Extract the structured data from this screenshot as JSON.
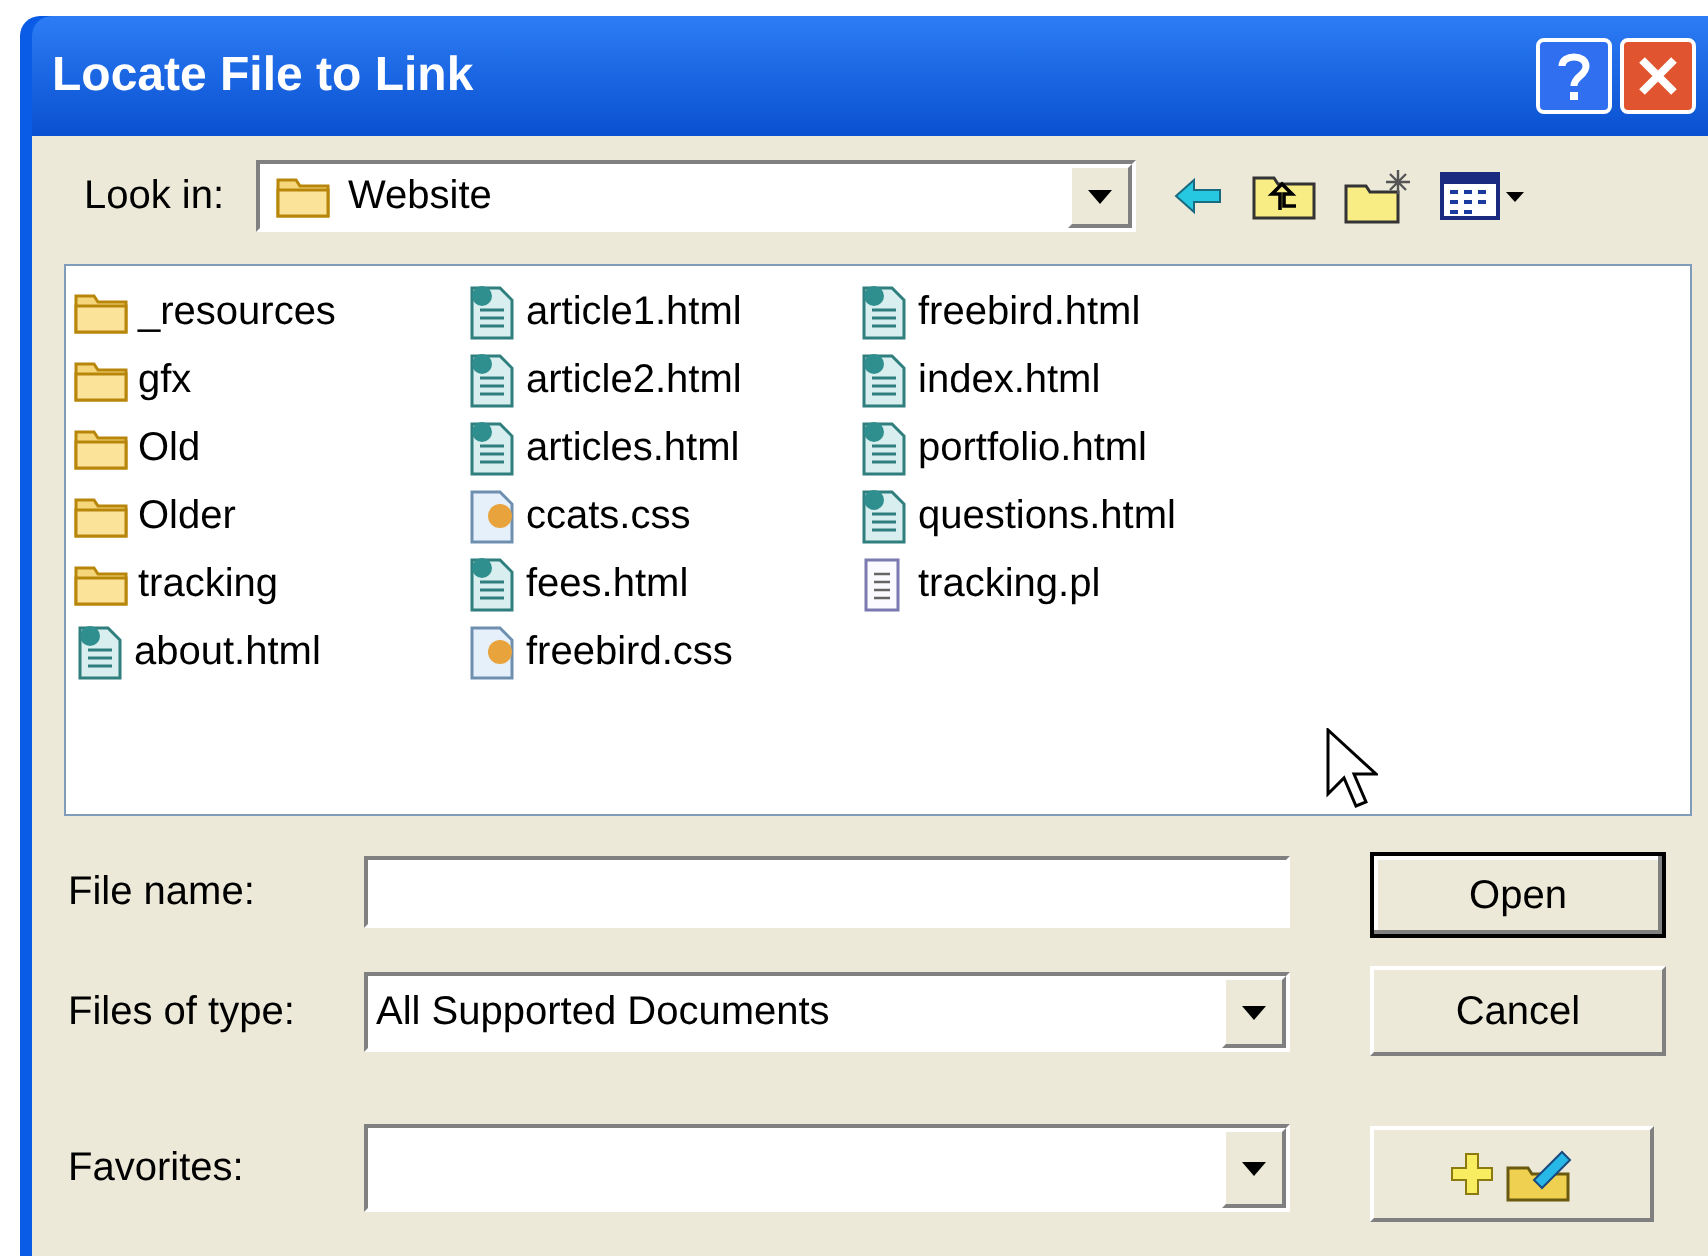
{
  "window": {
    "title": "Locate File to Link"
  },
  "look_in": {
    "label": "Look in:",
    "value": "Website"
  },
  "files": [
    [
      {
        "name": "_resources",
        "kind": "folder"
      },
      {
        "name": "gfx",
        "kind": "folder"
      },
      {
        "name": "Old",
        "kind": "folder"
      },
      {
        "name": "Older",
        "kind": "folder"
      },
      {
        "name": "tracking",
        "kind": "folder"
      },
      {
        "name": "about.html",
        "kind": "html"
      }
    ],
    [
      {
        "name": "article1.html",
        "kind": "html"
      },
      {
        "name": "article2.html",
        "kind": "html"
      },
      {
        "name": "articles.html",
        "kind": "html"
      },
      {
        "name": "ccats.css",
        "kind": "css"
      },
      {
        "name": "fees.html",
        "kind": "html"
      },
      {
        "name": "freebird.css",
        "kind": "css"
      }
    ],
    [
      {
        "name": "freebird.html",
        "kind": "html"
      },
      {
        "name": "index.html",
        "kind": "html"
      },
      {
        "name": "portfolio.html",
        "kind": "html"
      },
      {
        "name": "questions.html",
        "kind": "html"
      },
      {
        "name": "tracking.pl",
        "kind": "text"
      }
    ]
  ],
  "file_name": {
    "label": "File name:"
  },
  "files_of_type": {
    "label": "Files of type:",
    "value": "All Supported Documents"
  },
  "favorites": {
    "label": "Favorites:"
  },
  "buttons": {
    "open": "Open",
    "cancel": "Cancel"
  }
}
